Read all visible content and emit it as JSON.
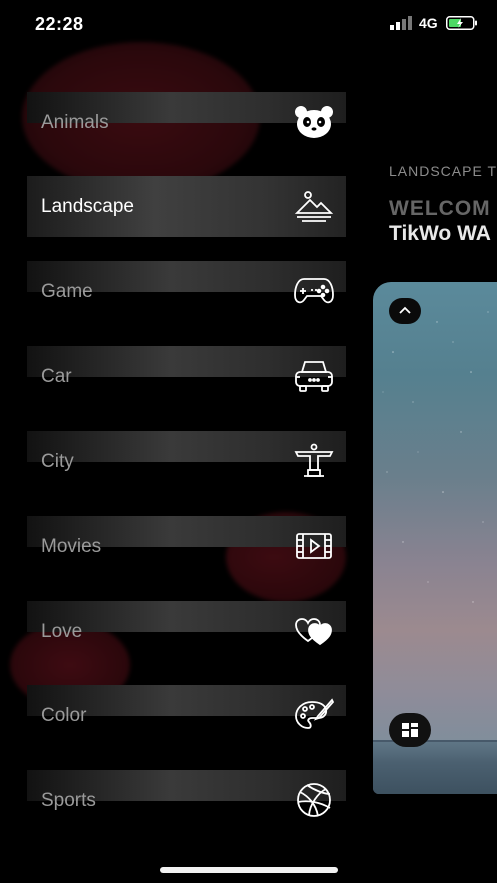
{
  "status": {
    "time": "22:28",
    "network": "4G"
  },
  "menu": {
    "items": [
      {
        "label": "Animals",
        "icon": "panda-icon",
        "active": false
      },
      {
        "label": "Landscape",
        "icon": "mountain-icon",
        "active": true
      },
      {
        "label": "Game",
        "icon": "gamepad-icon",
        "active": false
      },
      {
        "label": "Car",
        "icon": "car-icon",
        "active": false
      },
      {
        "label": "City",
        "icon": "monument-icon",
        "active": false
      },
      {
        "label": "Movies",
        "icon": "film-icon",
        "active": false
      },
      {
        "label": "Love",
        "icon": "hearts-icon",
        "active": false
      },
      {
        "label": "Color",
        "icon": "palette-icon",
        "active": false
      },
      {
        "label": "Sports",
        "icon": "basketball-icon",
        "active": false
      }
    ]
  },
  "panel": {
    "section_tag": "LANDSCAPE T",
    "welcome": "WELCOM",
    "brand": "TikWo WA"
  },
  "colors": {
    "background": "#000000",
    "accent_blob": "#3a0b10",
    "active_text": "#ffffff",
    "inactive_text": "#9a9a9a"
  }
}
